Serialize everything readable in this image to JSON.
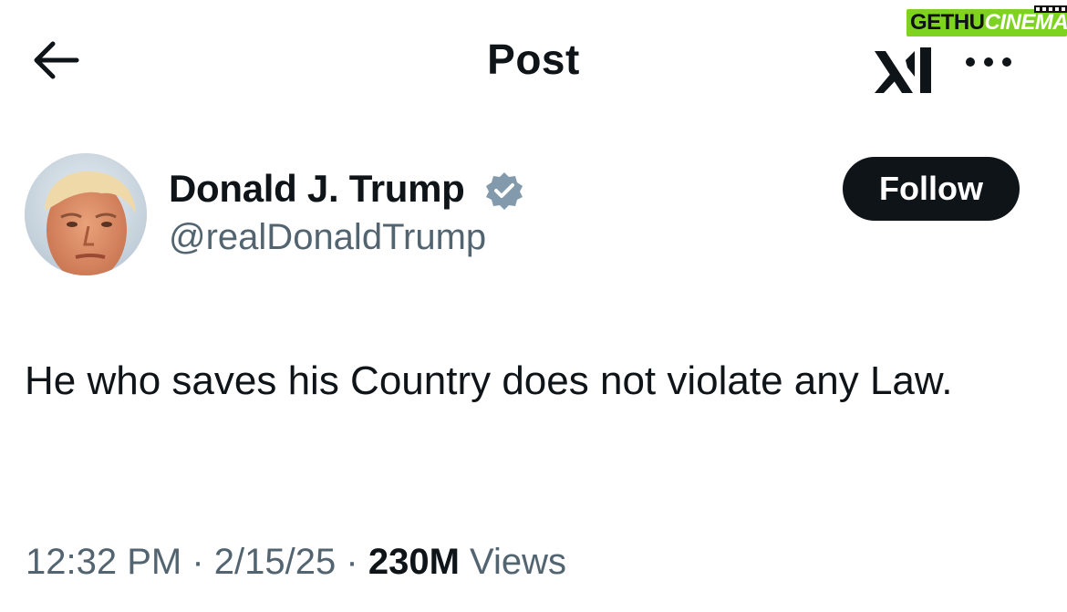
{
  "header": {
    "title": "Post",
    "back_icon": "arrow-left-icon",
    "logo": "xai-logo",
    "more_icon": "more-horizontal-icon"
  },
  "watermark": {
    "part1": "GETHU",
    "part2": "CINEMA",
    "color": "#7ed321"
  },
  "author": {
    "name": "Donald J. Trump",
    "handle": "@realDonaldTrump",
    "verified": true,
    "verified_color": "#829aab",
    "avatar": "avatar-photo"
  },
  "follow_button": {
    "label": "Follow"
  },
  "post": {
    "text": "He who saves his Country does not violate any Law."
  },
  "meta": {
    "time": "12:32 PM",
    "date": "2/15/25",
    "views_count": "230M",
    "views_label": "Views",
    "separator": "·"
  }
}
